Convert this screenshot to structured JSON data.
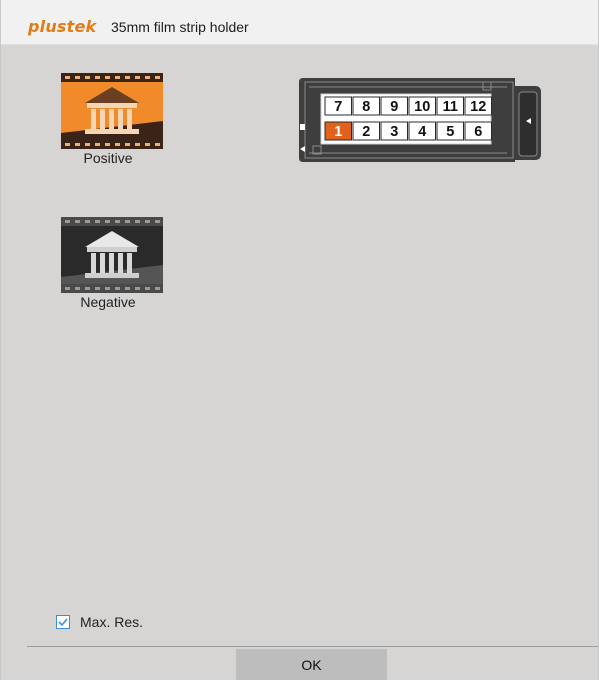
{
  "window": {
    "brand": "plustek",
    "title": "35mm film strip holder"
  },
  "film_types": [
    {
      "label": "Positive",
      "icon": "positive-film-icon",
      "selected": true
    },
    {
      "label": "Negative",
      "icon": "negative-film-icon",
      "selected": false
    }
  ],
  "holder": {
    "top_row": [
      "7",
      "8",
      "9",
      "10",
      "11",
      "12"
    ],
    "bottom_row": [
      "1",
      "2",
      "3",
      "4",
      "5",
      "6"
    ],
    "selected_frame": "1",
    "eject_icon": "arrow-left-icon"
  },
  "options": {
    "max_res_label": "Max. Res.",
    "max_res_checked": true
  },
  "footer": {
    "ok_label": "OK"
  },
  "colors": {
    "brand": "#e07d1a",
    "accent_selected": "#e2621c",
    "checkbox": "#3b8ed8",
    "background": "#d7d5d3"
  }
}
